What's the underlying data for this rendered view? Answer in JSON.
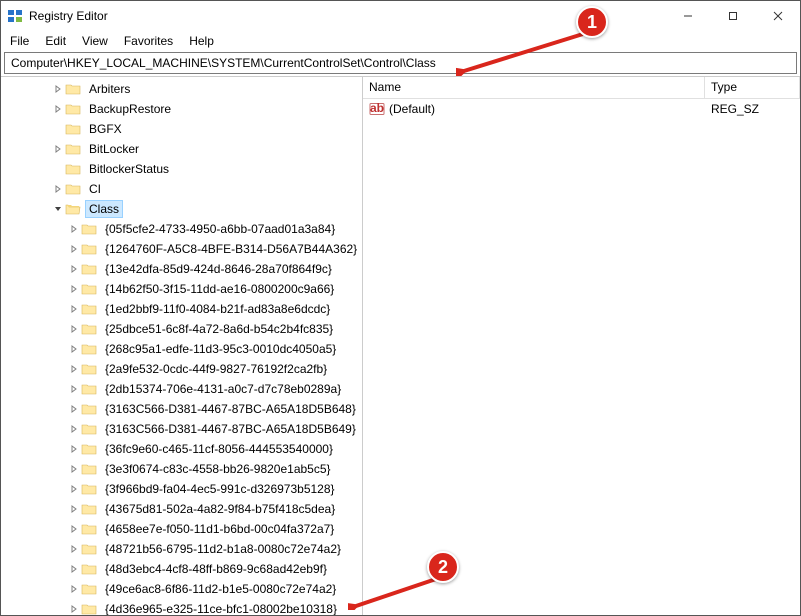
{
  "title": "Registry Editor",
  "menus": {
    "file": "File",
    "edit": "Edit",
    "view": "View",
    "favorites": "Favorites",
    "help": "Help"
  },
  "address": "Computer\\HKEY_LOCAL_MACHINE\\SYSTEM\\CurrentControlSet\\Control\\Class",
  "tree": {
    "top_items": [
      {
        "label": "Arbiters",
        "indent": 3,
        "expandable": true
      },
      {
        "label": "BackupRestore",
        "indent": 3,
        "expandable": true
      },
      {
        "label": "BGFX",
        "indent": 3,
        "expandable": false
      },
      {
        "label": "BitLocker",
        "indent": 3,
        "expandable": true
      },
      {
        "label": "BitlockerStatus",
        "indent": 3,
        "expandable": false
      },
      {
        "label": "CI",
        "indent": 3,
        "expandable": true
      }
    ],
    "selected": {
      "label": "Class",
      "indent": 3,
      "expanded": true
    },
    "class_children": [
      "{05f5cfe2-4733-4950-a6bb-07aad01a3a84}",
      "{1264760F-A5C8-4BFE-B314-D56A7B44A362}",
      "{13e42dfa-85d9-424d-8646-28a70f864f9c}",
      "{14b62f50-3f15-11dd-ae16-0800200c9a66}",
      "{1ed2bbf9-11f0-4084-b21f-ad83a8e6dcdc}",
      "{25dbce51-6c8f-4a72-8a6d-b54c2b4fc835}",
      "{268c95a1-edfe-11d3-95c3-0010dc4050a5}",
      "{2a9fe532-0cdc-44f9-9827-76192f2ca2fb}",
      "{2db15374-706e-4131-a0c7-d7c78eb0289a}",
      "{3163C566-D381-4467-87BC-A65A18D5B648}",
      "{3163C566-D381-4467-87BC-A65A18D5B649}",
      "{36fc9e60-c465-11cf-8056-444553540000}",
      "{3e3f0674-c83c-4558-bb26-9820e1ab5c5}",
      "{3f966bd9-fa04-4ec5-991c-d326973b5128}",
      "{43675d81-502a-4a82-9f84-b75f418c5dea}",
      "{4658ee7e-f050-11d1-b6bd-00c04fa372a7}",
      "{48721b56-6795-11d2-b1a8-0080c72e74a2}",
      "{48d3ebc4-4cf8-48ff-b869-9c68ad42eb9f}",
      "{49ce6ac8-6f86-11d2-b1e5-0080c72e74a2}",
      "{4d36e965-e325-11ce-bfc1-08002be10318}"
    ]
  },
  "list": {
    "headers": {
      "name": "Name",
      "type": "Type"
    },
    "rows": [
      {
        "name": "(Default)",
        "type": "REG_SZ"
      }
    ]
  },
  "annotations": {
    "badge1": "1",
    "badge2": "2"
  }
}
